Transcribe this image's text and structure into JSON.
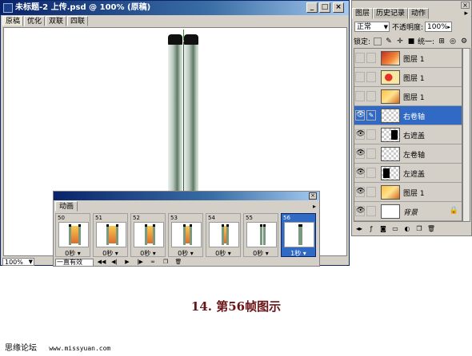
{
  "document": {
    "title": "未标题-2 上传.psd @ 100% (原稿)",
    "tabs": [
      "原稿",
      "优化",
      "双联",
      "四联"
    ],
    "active_tab": 0,
    "zoom": "100%",
    "window_buttons": [
      "_",
      "□",
      "×"
    ]
  },
  "layers_panel": {
    "tabs": [
      "图层",
      "历史记录",
      "动作"
    ],
    "active_tab": 0,
    "blend_mode": "正常",
    "opacity_label": "不透明度:",
    "opacity_value": "100%",
    "lock_label": "锁定:",
    "unify_label": "统一:",
    "layers": [
      {
        "name": "图层 1",
        "visible": false,
        "thumb": "img-red",
        "selected": false,
        "italic": false,
        "locked": false
      },
      {
        "name": "图层 1",
        "visible": false,
        "thumb": "img-flower",
        "selected": false,
        "italic": false,
        "locked": false
      },
      {
        "name": "图层 1",
        "visible": false,
        "thumb": "img-orange",
        "selected": false,
        "italic": false,
        "locked": false
      },
      {
        "name": "右卷轴",
        "visible": true,
        "thumb": "transparent",
        "selected": true,
        "italic": false,
        "locked": false
      },
      {
        "name": "右遮盖",
        "visible": true,
        "thumb": "mask-right",
        "selected": false,
        "italic": false,
        "locked": false
      },
      {
        "name": "左卷轴",
        "visible": true,
        "thumb": "transparent",
        "selected": false,
        "italic": false,
        "locked": false
      },
      {
        "name": "左遮盖",
        "visible": true,
        "thumb": "mask-left",
        "selected": false,
        "italic": false,
        "locked": false
      },
      {
        "name": "图层 1",
        "visible": true,
        "thumb": "img-orange",
        "selected": false,
        "italic": false,
        "locked": false
      },
      {
        "name": "背景",
        "visible": true,
        "thumb": "white",
        "selected": false,
        "italic": true,
        "locked": true
      }
    ]
  },
  "animation_panel": {
    "tab": "动画",
    "loop_value": "一直有效",
    "frames": [
      {
        "num": "50",
        "time": "0秒",
        "selected": false,
        "fill": 0.55
      },
      {
        "num": "51",
        "time": "0秒",
        "selected": false,
        "fill": 0.5
      },
      {
        "num": "52",
        "time": "0秒",
        "selected": false,
        "fill": 0.4
      },
      {
        "num": "53",
        "time": "0秒",
        "selected": false,
        "fill": 0.3
      },
      {
        "num": "54",
        "time": "0秒",
        "selected": false,
        "fill": 0.2
      },
      {
        "num": "55",
        "time": "0秒",
        "selected": false,
        "fill": 0.1
      },
      {
        "num": "56",
        "time": "1秒",
        "selected": true,
        "fill": 0
      }
    ]
  },
  "caption": "14. 第56帧图示",
  "credit": {
    "name": "思缘论坛",
    "site": "www.missyuan.com"
  },
  "colors": {
    "titlebar": "#0a246a",
    "selection": "#316ac5",
    "caption": "#6b1216",
    "panel_bg": "#d4d0c8"
  }
}
